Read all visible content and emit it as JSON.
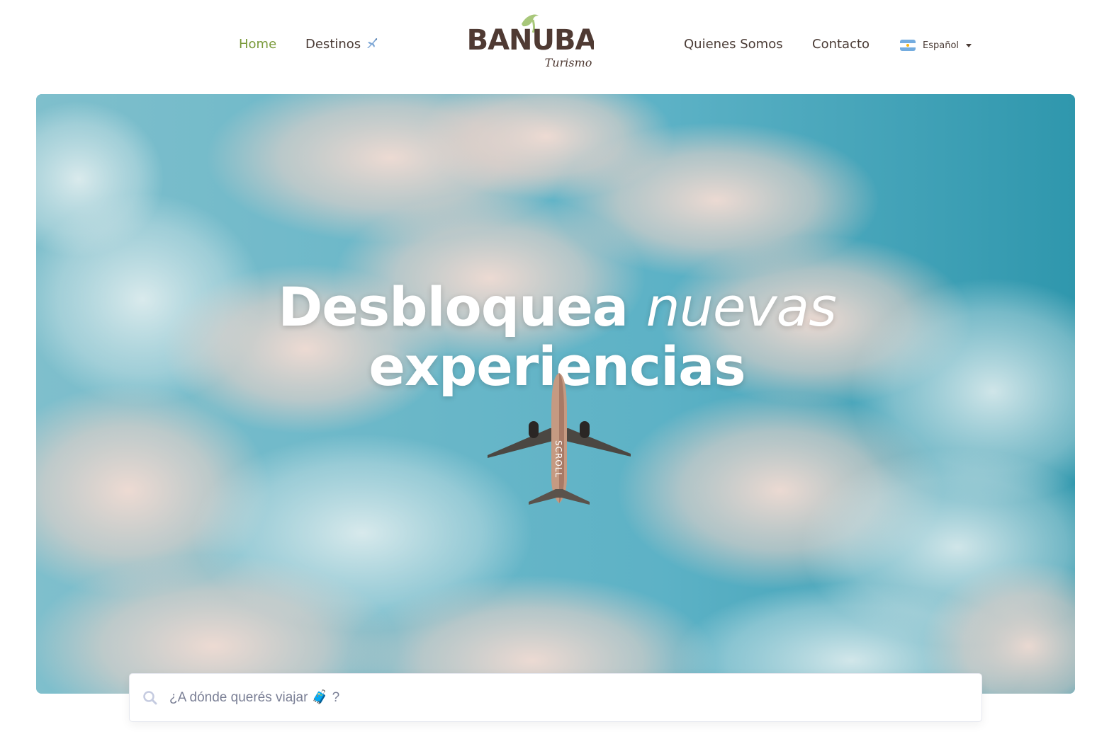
{
  "nav": {
    "home": "Home",
    "destinos": "Destinos",
    "destinos_emoji": "✈️",
    "quienes_somos": "Quienes Somos",
    "contacto": "Contacto"
  },
  "logo": {
    "wordmark": "BANUBA",
    "tagline": "Turismo"
  },
  "language": {
    "selected": "Español",
    "flag": "argentina-flag-icon"
  },
  "hero": {
    "headline_bold": "Desbloquea",
    "headline_italic": "nuevas",
    "headline_line2": "experiencias",
    "scroll_label": "SCROLL"
  },
  "search": {
    "placeholder": "¿A dónde querés viajar 🧳 ?"
  },
  "colors": {
    "accent_green": "#7a9a3a",
    "text_brown": "#4a3b35",
    "sky": "#5fb0c4"
  }
}
